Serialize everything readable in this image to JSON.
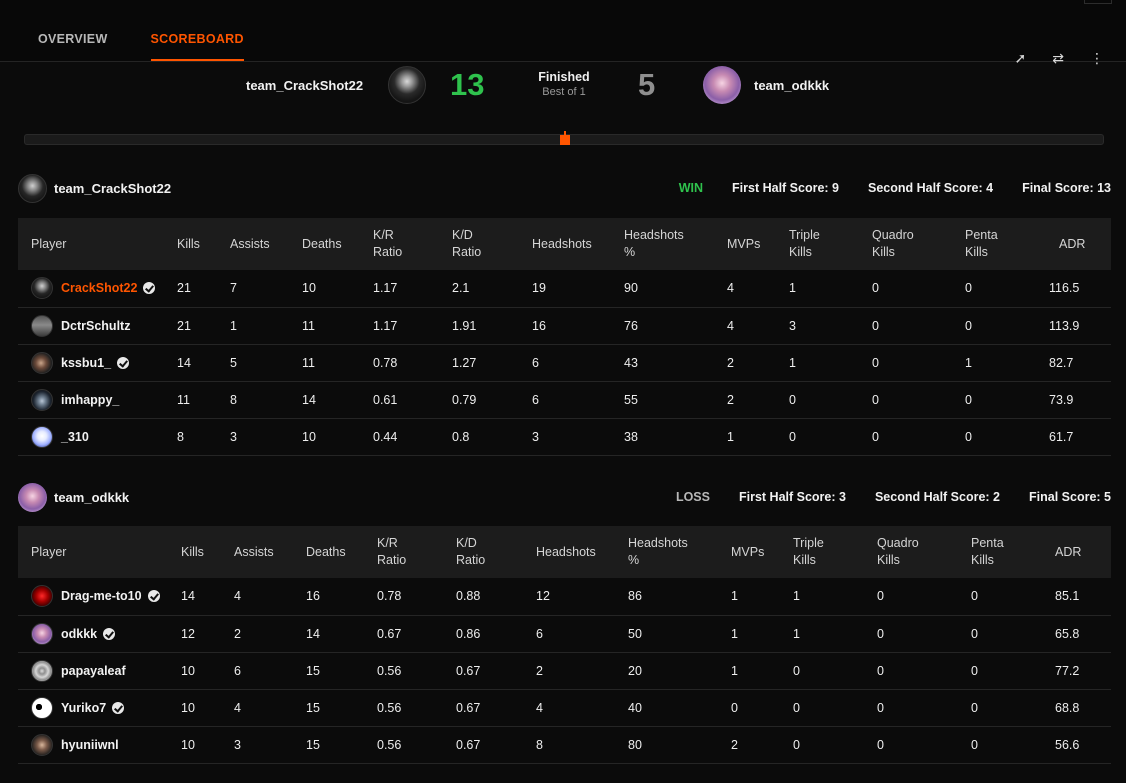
{
  "tabs": [
    {
      "label": "OVERVIEW",
      "active": false
    },
    {
      "label": "SCOREBOARD",
      "active": true
    }
  ],
  "header_icons": [
    "share-icon",
    "compare-icon",
    "more-icon"
  ],
  "match": {
    "team_a": {
      "name": "team_CrackShot22",
      "score": "13"
    },
    "team_b": {
      "name": "team_odkkk",
      "score": "5"
    },
    "status": "Finished",
    "format": "Best of 1"
  },
  "columns": [
    "Player",
    "Kills",
    "Assists",
    "Deaths",
    "K/R\nRatio",
    "K/D\nRatio",
    "Headshots",
    "Headshots\n%",
    "MVPs",
    "Triple\nKills",
    "Quadro\nKills",
    "Penta\nKills",
    "ADR"
  ],
  "teams": [
    {
      "name": "team_CrackShot22",
      "result": "WIN",
      "first_half": "First Half Score: 9",
      "second_half": "Second Half Score: 4",
      "final": "Final Score: 13",
      "players": [
        {
          "name": "CrackShot22",
          "verified": true,
          "highlight": true,
          "stats": [
            "21",
            "7",
            "10",
            "1.17",
            "2.1",
            "19",
            "90",
            "4",
            "1",
            "0",
            "0",
            "116.5"
          ]
        },
        {
          "name": "DctrSchultz",
          "verified": false,
          "highlight": false,
          "stats": [
            "21",
            "1",
            "11",
            "1.17",
            "1.91",
            "16",
            "76",
            "4",
            "3",
            "0",
            "0",
            "113.9"
          ]
        },
        {
          "name": "kssbu1_",
          "verified": true,
          "highlight": false,
          "stats": [
            "14",
            "5",
            "11",
            "0.78",
            "1.27",
            "6",
            "43",
            "2",
            "1",
            "0",
            "1",
            "82.7"
          ]
        },
        {
          "name": "imhappy_",
          "verified": false,
          "highlight": false,
          "stats": [
            "11",
            "8",
            "14",
            "0.61",
            "0.79",
            "6",
            "55",
            "2",
            "0",
            "0",
            "0",
            "73.9"
          ]
        },
        {
          "name": "_310",
          "verified": false,
          "highlight": false,
          "stats": [
            "8",
            "3",
            "10",
            "0.44",
            "0.8",
            "3",
            "38",
            "1",
            "0",
            "0",
            "0",
            "61.7"
          ]
        }
      ]
    },
    {
      "name": "team_odkkk",
      "result": "LOSS",
      "first_half": "First Half Score: 3",
      "second_half": "Second Half Score: 2",
      "final": "Final Score: 5",
      "players": [
        {
          "name": "Drag-me-to10",
          "verified": true,
          "highlight": false,
          "stats": [
            "14",
            "4",
            "16",
            "0.78",
            "0.88",
            "12",
            "86",
            "1",
            "1",
            "0",
            "0",
            "85.1"
          ]
        },
        {
          "name": "odkkk",
          "verified": true,
          "highlight": false,
          "stats": [
            "12",
            "2",
            "14",
            "0.67",
            "0.86",
            "6",
            "50",
            "1",
            "1",
            "0",
            "0",
            "65.8"
          ]
        },
        {
          "name": "papayaleaf",
          "verified": false,
          "highlight": false,
          "stats": [
            "10",
            "6",
            "15",
            "0.56",
            "0.67",
            "2",
            "20",
            "1",
            "0",
            "0",
            "0",
            "77.2"
          ]
        },
        {
          "name": "Yuriko7",
          "verified": true,
          "highlight": false,
          "stats": [
            "10",
            "4",
            "15",
            "0.56",
            "0.67",
            "4",
            "40",
            "0",
            "0",
            "0",
            "0",
            "68.8"
          ]
        },
        {
          "name": "hyuniiwnl",
          "verified": false,
          "highlight": false,
          "stats": [
            "10",
            "3",
            "15",
            "0.56",
            "0.67",
            "8",
            "80",
            "2",
            "0",
            "0",
            "0",
            "56.6"
          ]
        }
      ]
    }
  ],
  "colors": {
    "accent": "#ff5500",
    "win": "#2fc24d",
    "background": "#0b0b0b",
    "table_header": "#1c1c1c"
  }
}
